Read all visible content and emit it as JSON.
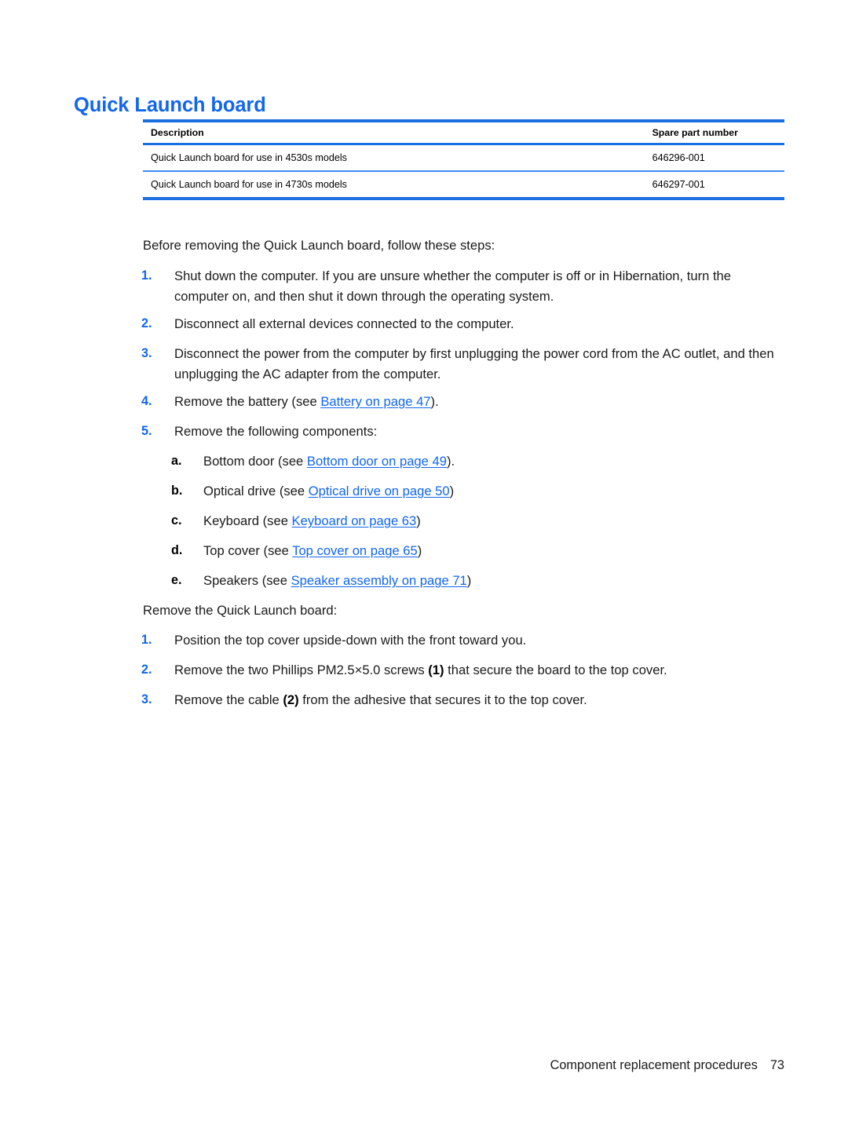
{
  "document": {
    "title": "Quick Launch board",
    "footer_text": "Component replacement procedures",
    "footer_page_number": "73"
  },
  "spec_table": {
    "columns": [
      "Description",
      "Spare part number"
    ],
    "rows": [
      {
        "description": "Quick Launch board for use in 4530s models",
        "spare_part_number": "646296-001"
      },
      {
        "description": "Quick Launch board for use in 4730s models",
        "spare_part_number": "646297-001"
      }
    ]
  },
  "before_section": {
    "intro": "Before removing the Quick Launch board, follow these steps:",
    "steps": [
      {
        "marker": "1.",
        "text": "Shut down the computer. If you are unsure whether the computer is off or in Hibernation, turn the computer on, and then shut it down through the operating system."
      },
      {
        "marker": "2.",
        "text": "Disconnect all external devices connected to the computer."
      },
      {
        "marker": "3.",
        "text": "Disconnect the power from the computer by first unplugging the power cord from the AC outlet, and then unplugging the AC adapter from the computer."
      },
      {
        "marker": "4.",
        "text_before": "Remove the battery (see ",
        "link": "Battery on page 47",
        "text_after": ")."
      },
      {
        "marker": "5.",
        "text": "Remove the following components:"
      }
    ],
    "sub_steps": [
      {
        "marker": "a.",
        "text_before": "Bottom door (see ",
        "link": "Bottom door on page 49",
        "text_after": ")."
      },
      {
        "marker": "b.",
        "text_before": "Optical drive (see ",
        "link": "Optical drive on page 50",
        "text_after": ")"
      },
      {
        "marker": "c.",
        "text_before": "Keyboard (see ",
        "link": "Keyboard on page 63",
        "text_after": ")"
      },
      {
        "marker": "d.",
        "text_before": "Top cover (see ",
        "link": "Top cover on page 65",
        "text_after": ")"
      },
      {
        "marker": "e.",
        "text_before": "Speakers (see ",
        "link": "Speaker assembly on page 71",
        "text_after": ")"
      }
    ]
  },
  "remove_section": {
    "intro": "Remove the Quick Launch board:",
    "steps": [
      {
        "marker": "1.",
        "text": "Position the top cover upside-down with the front toward you."
      },
      {
        "marker": "2.",
        "text_before": "Remove the two Phillips PM2.5×5.0 screws ",
        "callout": "(1)",
        "text_after": " that secure the board to the top cover."
      },
      {
        "marker": "3.",
        "text_before": "Remove the cable ",
        "callout": "(2)",
        "text_after": " from the adhesive that secures it to the top cover."
      }
    ]
  },
  "colors": {
    "heading_blue": "#1166ee",
    "link_blue": "#1166ee",
    "rule_blue": "#1a6fe0",
    "inner_rule_blue": "#3d8bf2"
  }
}
